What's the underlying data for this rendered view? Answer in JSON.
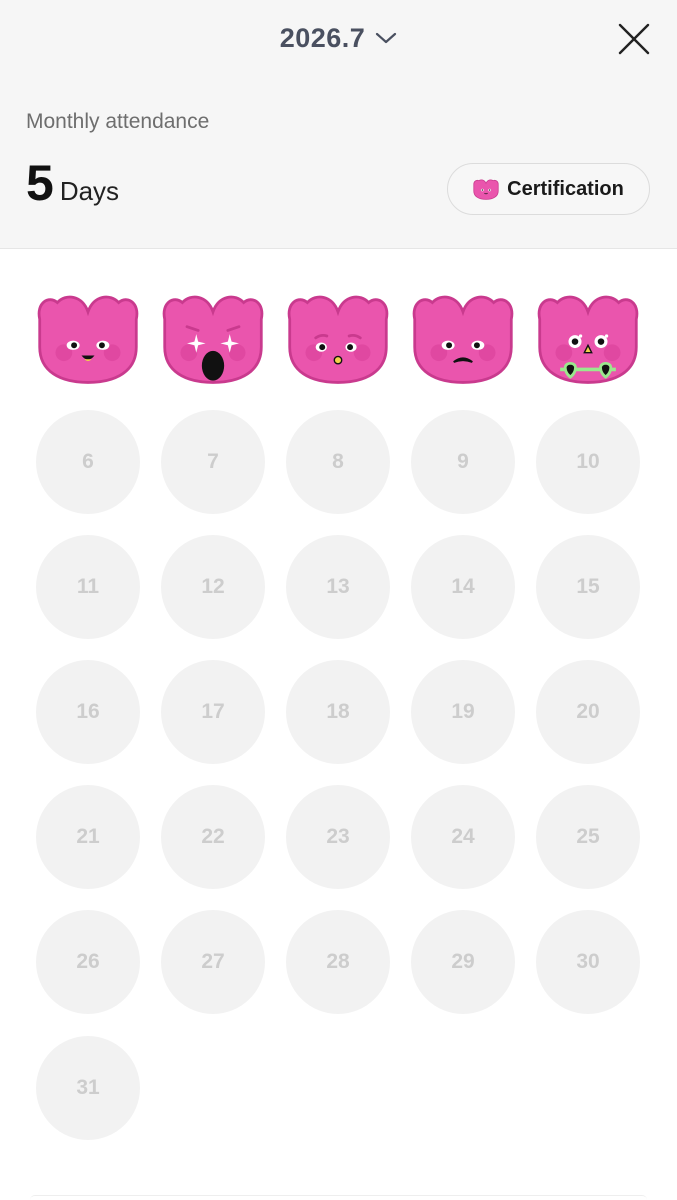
{
  "header": {
    "month": "2026.7",
    "title": "Monthly attendance",
    "count": "5",
    "count_unit": "Days",
    "certification_label": "Certification"
  },
  "colors": {
    "stamp_pink": "#ea55ad",
    "stamp_outline": "#c93a8e",
    "empty_circle": "#f2f2f2",
    "empty_number": "#cdcdcd",
    "sunglasses": "#9be88e"
  },
  "attended": [
    {
      "day": 1,
      "face": "smile-tongue"
    },
    {
      "day": 2,
      "face": "starry-shocked"
    },
    {
      "day": 3,
      "face": "worried-small-mouth"
    },
    {
      "day": 4,
      "face": "frown"
    },
    {
      "day": 5,
      "face": "sunglasses-sparkle"
    }
  ],
  "days": [
    "6",
    "7",
    "8",
    "9",
    "10",
    "11",
    "12",
    "13",
    "14",
    "15",
    "16",
    "17",
    "18",
    "19",
    "20",
    "21",
    "22",
    "23",
    "24",
    "25",
    "26",
    "27",
    "28",
    "29",
    "30",
    "31"
  ]
}
